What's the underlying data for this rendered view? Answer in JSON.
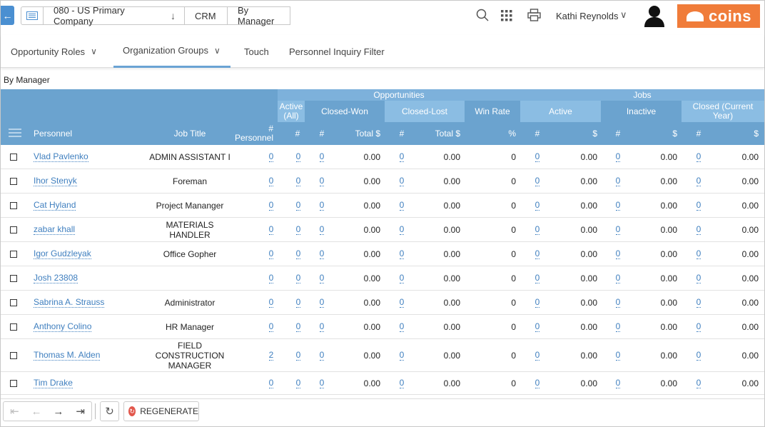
{
  "nav": {
    "crumbs": [
      "080 - US Primary Company",
      "CRM",
      "By Manager"
    ],
    "user": "Kathi Reynolds",
    "logo": "coins"
  },
  "tabs": [
    "Opportunity Roles",
    "Organization Groups",
    "Touch",
    "Personnel Inquiry Filter"
  ],
  "section_label": "By Manager",
  "headers": {
    "opportunities": "Opportunities",
    "jobs": "Jobs",
    "active_all": "Active (All)",
    "closed_won": "Closed-Won",
    "closed_lost": "Closed-Lost",
    "win_rate": "Win Rate",
    "active": "Active",
    "inactive": "Inactive",
    "closed_current_year": "Closed (Current Year)",
    "personnel": "Personnel",
    "job_title": "Job Title",
    "num_personnel": "# Personnel",
    "hash": "#",
    "total_dollar": "Total $",
    "percent": "%",
    "dollar": "$"
  },
  "rows": [
    {
      "name": "Vlad Pavlenko",
      "title": "ADMIN ASSISTANT I",
      "personnel": "0",
      "active": "0",
      "won_n": "0",
      "won_total": "0.00",
      "lost_n": "0",
      "lost_total": "0.00",
      "win": "0",
      "ja_n": "0",
      "ja_d": "0.00",
      "ji_n": "0",
      "ji_d": "0.00",
      "jc_n": "0",
      "jc_d": "0.00"
    },
    {
      "name": "Ihor Stenyk",
      "title": "Foreman",
      "personnel": "0",
      "active": "0",
      "won_n": "0",
      "won_total": "0.00",
      "lost_n": "0",
      "lost_total": "0.00",
      "win": "0",
      "ja_n": "0",
      "ja_d": "0.00",
      "ji_n": "0",
      "ji_d": "0.00",
      "jc_n": "0",
      "jc_d": "0.00"
    },
    {
      "name": "Cat Hyland",
      "title": "Project Mananger",
      "personnel": "0",
      "active": "0",
      "won_n": "0",
      "won_total": "0.00",
      "lost_n": "0",
      "lost_total": "0.00",
      "win": "0",
      "ja_n": "0",
      "ja_d": "0.00",
      "ji_n": "0",
      "ji_d": "0.00",
      "jc_n": "0",
      "jc_d": "0.00"
    },
    {
      "name": "zabar khall",
      "title": "MATERIALS HANDLER",
      "personnel": "0",
      "active": "0",
      "won_n": "0",
      "won_total": "0.00",
      "lost_n": "0",
      "lost_total": "0.00",
      "win": "0",
      "ja_n": "0",
      "ja_d": "0.00",
      "ji_n": "0",
      "ji_d": "0.00",
      "jc_n": "0",
      "jc_d": "0.00"
    },
    {
      "name": "Igor Gudzleyak",
      "title": "Office Gopher",
      "personnel": "0",
      "active": "0",
      "won_n": "0",
      "won_total": "0.00",
      "lost_n": "0",
      "lost_total": "0.00",
      "win": "0",
      "ja_n": "0",
      "ja_d": "0.00",
      "ji_n": "0",
      "ji_d": "0.00",
      "jc_n": "0",
      "jc_d": "0.00"
    },
    {
      "name": "Josh 23808",
      "title": "",
      "personnel": "0",
      "active": "0",
      "won_n": "0",
      "won_total": "0.00",
      "lost_n": "0",
      "lost_total": "0.00",
      "win": "0",
      "ja_n": "0",
      "ja_d": "0.00",
      "ji_n": "0",
      "ji_d": "0.00",
      "jc_n": "0",
      "jc_d": "0.00"
    },
    {
      "name": "Sabrina A. Strauss",
      "title": "Administrator",
      "personnel": "0",
      "active": "0",
      "won_n": "0",
      "won_total": "0.00",
      "lost_n": "0",
      "lost_total": "0.00",
      "win": "0",
      "ja_n": "0",
      "ja_d": "0.00",
      "ji_n": "0",
      "ji_d": "0.00",
      "jc_n": "0",
      "jc_d": "0.00"
    },
    {
      "name": "Anthony Colino",
      "title": "HR Manager",
      "personnel": "0",
      "active": "0",
      "won_n": "0",
      "won_total": "0.00",
      "lost_n": "0",
      "lost_total": "0.00",
      "win": "0",
      "ja_n": "0",
      "ja_d": "0.00",
      "ji_n": "0",
      "ji_d": "0.00",
      "jc_n": "0",
      "jc_d": "0.00"
    },
    {
      "name": "Thomas M. Alden",
      "title": "FIELD CONSTRUCTION MANAGER",
      "personnel": "2",
      "active": "0",
      "won_n": "0",
      "won_total": "0.00",
      "lost_n": "0",
      "lost_total": "0.00",
      "win": "0",
      "ja_n": "0",
      "ja_d": "0.00",
      "ji_n": "0",
      "ji_d": "0.00",
      "jc_n": "0",
      "jc_d": "0.00"
    },
    {
      "name": "Tim Drake",
      "title": "",
      "personnel": "0",
      "active": "0",
      "won_n": "0",
      "won_total": "0.00",
      "lost_n": "0",
      "lost_total": "0.00",
      "win": "0",
      "ja_n": "0",
      "ja_d": "0.00",
      "ji_n": "0",
      "ji_d": "0.00",
      "jc_n": "0",
      "jc_d": "0.00"
    }
  ],
  "toolbar": {
    "regenerate": "REGENERATE"
  },
  "colors": {
    "header": "#6ba3cf",
    "link": "#3f7fbf",
    "logo": "#f07c3a",
    "regen": "#e2574c"
  }
}
